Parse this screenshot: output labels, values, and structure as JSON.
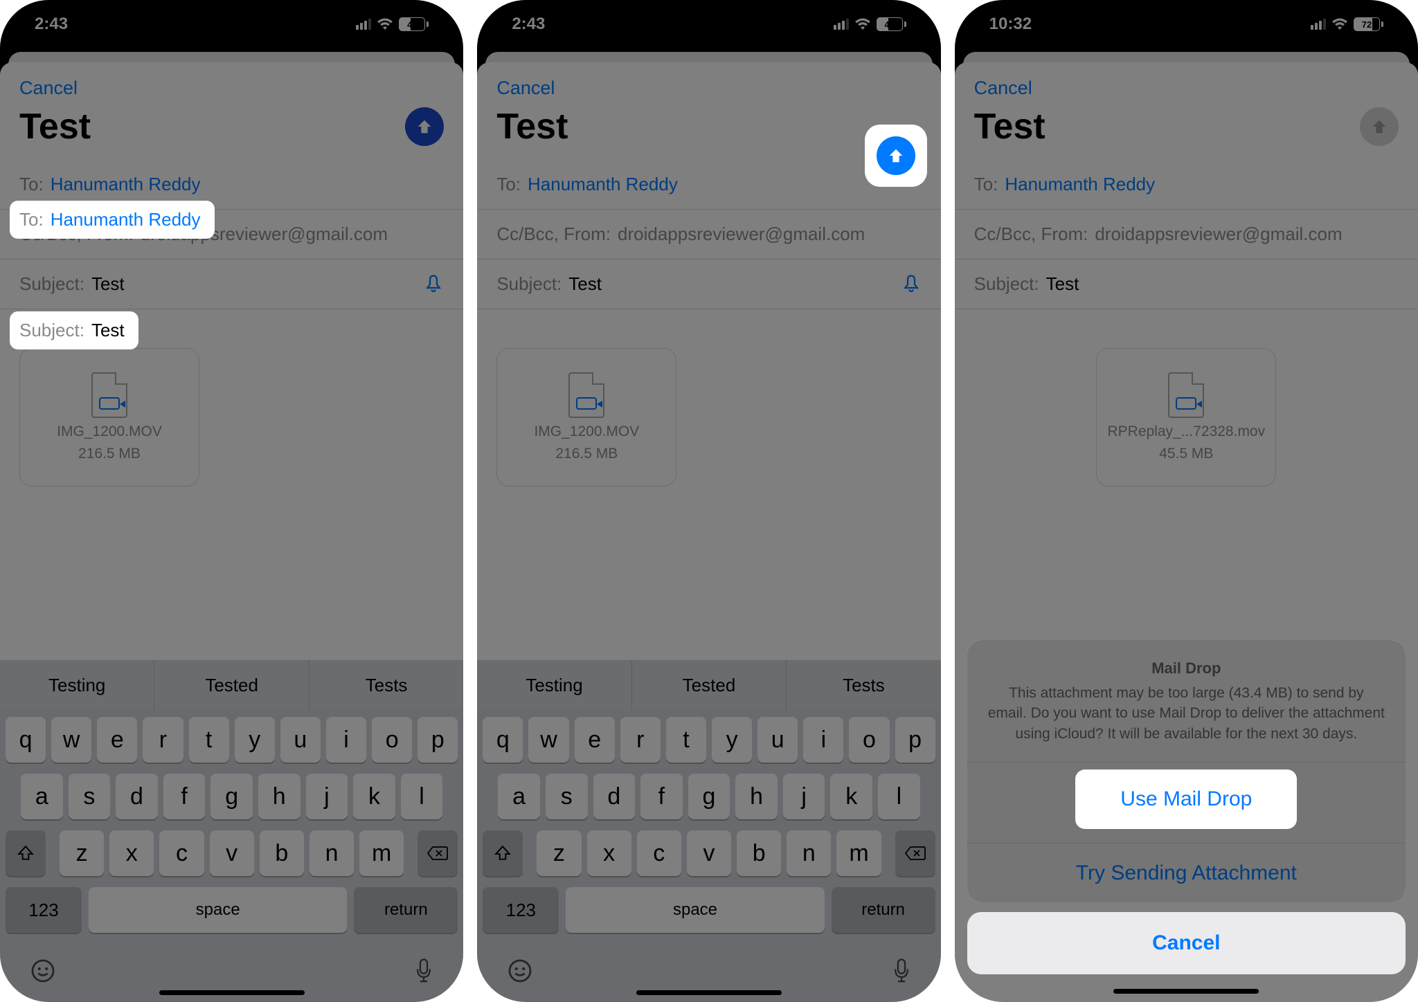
{
  "panel1": {
    "time": "2:43",
    "battery": "43",
    "cancel": "Cancel",
    "title": "Test",
    "to_label": "To:",
    "to_value": "Hanumanth Reddy",
    "ccbcc": "Cc/Bcc, From:",
    "from_value": "droidappsreviewer@gmail.com",
    "subject_label": "Subject:",
    "subject_value": "Test",
    "attach_name": "IMG_1200.MOV",
    "attach_size": "216.5 MB",
    "sugg": [
      "Testing",
      "Tested",
      "Tests"
    ],
    "row1": [
      "q",
      "w",
      "e",
      "r",
      "t",
      "y",
      "u",
      "i",
      "o",
      "p"
    ],
    "row2": [
      "a",
      "s",
      "d",
      "f",
      "g",
      "h",
      "j",
      "k",
      "l"
    ],
    "row3": [
      "z",
      "x",
      "c",
      "v",
      "b",
      "n",
      "m"
    ],
    "k123": "123",
    "space": "space",
    "return": "return"
  },
  "panel2": {
    "time": "2:43",
    "battery": "43",
    "cancel": "Cancel",
    "title": "Test",
    "to_label": "To:",
    "to_value": "Hanumanth Reddy",
    "ccbcc": "Cc/Bcc, From:",
    "from_value": "droidappsreviewer@gmail.com",
    "subject_label": "Subject:",
    "subject_value": "Test",
    "attach_name": "IMG_1200.MOV",
    "attach_size": "216.5 MB",
    "sugg": [
      "Testing",
      "Tested",
      "Tests"
    ],
    "row1": [
      "q",
      "w",
      "e",
      "r",
      "t",
      "y",
      "u",
      "i",
      "o",
      "p"
    ],
    "row2": [
      "a",
      "s",
      "d",
      "f",
      "g",
      "h",
      "j",
      "k",
      "l"
    ],
    "row3": [
      "z",
      "x",
      "c",
      "v",
      "b",
      "n",
      "m"
    ],
    "k123": "123",
    "space": "space",
    "return": "return"
  },
  "panel3": {
    "time": "10:32",
    "battery": "72",
    "cancel": "Cancel",
    "title": "Test",
    "to_label": "To:",
    "to_value": "Hanumanth Reddy",
    "ccbcc": "Cc/Bcc, From:",
    "from_value": "droidappsreviewer@gmail.com",
    "subject_label": "Subject:",
    "subject_value": "Test",
    "attach_name": "RPReplay_...72328.mov",
    "attach_size": "45.5 MB",
    "sheet_title": "Mail Drop",
    "sheet_body": "This attachment may be too large (43.4 MB) to send by email. Do you want to use Mail Drop to deliver the attachment using iCloud? It will be available for the next 30 days.",
    "use_maildrop": "Use Mail Drop",
    "try_send": "Try Sending Attachment",
    "action_cancel": "Cancel"
  }
}
